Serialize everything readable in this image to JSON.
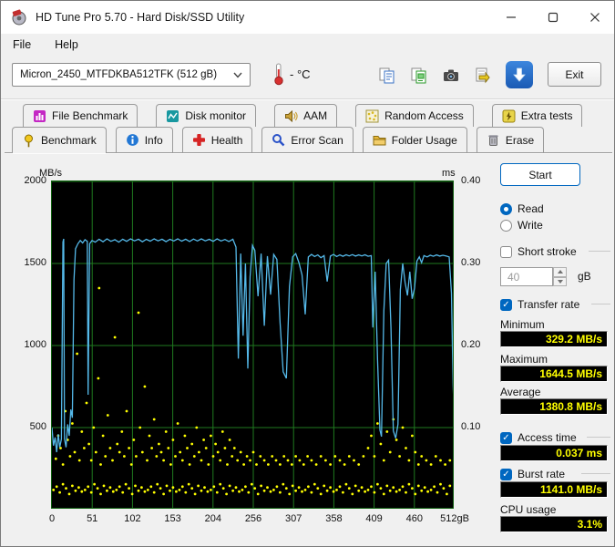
{
  "window": {
    "title": "HD Tune Pro 5.70 - Hard Disk/SSD Utility"
  },
  "menu": {
    "file": "File",
    "help": "Help"
  },
  "toolbar": {
    "drive_select": "Micron_2450_MTFDKBA512TFK (512 gB)",
    "temperature": "- °C",
    "exit": "Exit"
  },
  "tabs": {
    "active": "Benchmark",
    "row1": [
      {
        "label": "File Benchmark"
      },
      {
        "label": "Disk monitor"
      },
      {
        "label": "AAM"
      },
      {
        "label": "Random Access"
      },
      {
        "label": "Extra tests"
      }
    ],
    "row2": [
      {
        "label": "Benchmark"
      },
      {
        "label": "Info"
      },
      {
        "label": "Health"
      },
      {
        "label": "Error Scan"
      },
      {
        "label": "Folder Usage"
      },
      {
        "label": "Erase"
      }
    ]
  },
  "panel": {
    "start": "Start",
    "read": "Read",
    "read_checked": true,
    "write": "Write",
    "write_checked": false,
    "short_stroke": "Short stroke",
    "short_stroke_checked": false,
    "short_stroke_value": "40",
    "short_stroke_unit": "gB",
    "transfer_rate": "Transfer rate",
    "transfer_rate_checked": true,
    "minimum_label": "Minimum",
    "minimum_value": "329.2 MB/s",
    "maximum_label": "Maximum",
    "maximum_value": "1644.5 MB/s",
    "average_label": "Average",
    "average_value": "1380.8 MB/s",
    "access_time": "Access time",
    "access_time_checked": true,
    "access_time_value": "0.037 ms",
    "burst_rate": "Burst rate",
    "burst_rate_checked": true,
    "burst_rate_value": "1141.0 MB/s",
    "cpu_usage_label": "CPU usage",
    "cpu_usage_value": "3.1%"
  },
  "chart_data": {
    "type": "line",
    "title": "HD Tune benchmark: transfer rate and access time vs position",
    "left_axis": {
      "label": "MB/s",
      "min": 0,
      "max": 2000,
      "ticks": [
        2000,
        1500,
        1000,
        500
      ]
    },
    "right_axis": {
      "label": "ms",
      "min": 0,
      "max": 0.4,
      "ticks": [
        "0.40",
        "0.30",
        "0.20",
        "0.10"
      ]
    },
    "x_axis": {
      "min": 0,
      "max": 512,
      "tick_labels": [
        "0",
        "51",
        "102",
        "153",
        "204",
        "256",
        "307",
        "358",
        "409",
        "460",
        "512gB"
      ]
    },
    "colors": {
      "plot_bg": "#000000",
      "grid": "#1f7a1f",
      "transfer_line": "#55b9e9",
      "access_dots": "#ffff00"
    },
    "series": [
      {
        "name": "transfer_rate_mbs",
        "points": [
          [
            0,
            500
          ],
          [
            2,
            390
          ],
          [
            4,
            440
          ],
          [
            6,
            350
          ],
          [
            8,
            460
          ],
          [
            10,
            380
          ],
          [
            12,
            430
          ],
          [
            14,
            1630
          ],
          [
            15,
            1650
          ],
          [
            16,
            430
          ],
          [
            18,
            380
          ],
          [
            20,
            520
          ],
          [
            22,
            450
          ],
          [
            24,
            610
          ],
          [
            26,
            560
          ],
          [
            28,
            1400
          ],
          [
            30,
            1590
          ],
          [
            33,
            1620
          ],
          [
            36,
            1640
          ],
          [
            39,
            1625
          ],
          [
            42,
            1645
          ],
          [
            45,
            1635
          ],
          [
            46,
            700
          ],
          [
            48,
            1620
          ],
          [
            51,
            1640
          ],
          [
            55,
            1630
          ],
          [
            60,
            1648
          ],
          [
            65,
            1632
          ],
          [
            70,
            1650
          ],
          [
            75,
            1635
          ],
          [
            80,
            1645
          ],
          [
            85,
            1630
          ],
          [
            90,
            1648
          ],
          [
            95,
            1635
          ],
          [
            100,
            1650
          ],
          [
            105,
            1638
          ],
          [
            110,
            1648
          ],
          [
            115,
            1632
          ],
          [
            120,
            1647
          ],
          [
            125,
            1636
          ],
          [
            130,
            1650
          ],
          [
            135,
            1638
          ],
          [
            140,
            1648
          ],
          [
            145,
            1633
          ],
          [
            150,
            1647
          ],
          [
            155,
            1637
          ],
          [
            160,
            1650
          ],
          [
            165,
            1636
          ],
          [
            170,
            1648
          ],
          [
            175,
            1634
          ],
          [
            180,
            1649
          ],
          [
            185,
            1637
          ],
          [
            190,
            1650
          ],
          [
            195,
            1638
          ],
          [
            200,
            1647
          ],
          [
            205,
            1635
          ],
          [
            210,
            1650
          ],
          [
            215,
            1637
          ],
          [
            220,
            1646
          ],
          [
            225,
            1634
          ],
          [
            230,
            1648
          ],
          [
            234,
            1600
          ],
          [
            237,
            920
          ],
          [
            240,
            1560
          ],
          [
            243,
            1060
          ],
          [
            246,
            1500
          ],
          [
            249,
            860
          ],
          [
            252,
            1420
          ],
          [
            255,
            1610
          ],
          [
            258,
            1580
          ],
          [
            262,
            1300
          ],
          [
            266,
            1560
          ],
          [
            270,
            1120
          ],
          [
            274,
            1545
          ],
          [
            278,
            1310
          ],
          [
            282,
            1555
          ],
          [
            286,
            1525
          ],
          [
            290,
            1140
          ],
          [
            294,
            840
          ],
          [
            298,
            800
          ],
          [
            302,
            1360
          ],
          [
            306,
            1540
          ],
          [
            310,
            1560
          ],
          [
            314,
            1505
          ],
          [
            318,
            1430
          ],
          [
            322,
            1190
          ],
          [
            326,
            1540
          ],
          [
            330,
            1555
          ],
          [
            334,
            1542
          ],
          [
            338,
            1552
          ],
          [
            342,
            1535
          ],
          [
            346,
            1548
          ],
          [
            350,
            1390
          ],
          [
            354,
            1545
          ],
          [
            358,
            1555
          ],
          [
            362,
            1542
          ],
          [
            366,
            1552
          ],
          [
            370,
            1544
          ],
          [
            374,
            1553
          ],
          [
            378,
            1546
          ],
          [
            382,
            1554
          ],
          [
            386,
            1545
          ],
          [
            390,
            1552
          ],
          [
            394,
            1546
          ],
          [
            398,
            1553
          ],
          [
            402,
            1544
          ],
          [
            406,
            1548
          ],
          [
            408,
            1110
          ],
          [
            411,
            1450
          ],
          [
            414,
            910
          ],
          [
            417,
            485
          ],
          [
            419,
            445
          ],
          [
            422,
            1210
          ],
          [
            425,
            1500
          ],
          [
            428,
            1520
          ],
          [
            431,
            1110
          ],
          [
            434,
            480
          ],
          [
            437,
            435
          ],
          [
            440,
            520
          ],
          [
            443,
            1340
          ],
          [
            446,
            1500
          ],
          [
            449,
            1385
          ],
          [
            452,
            1305
          ],
          [
            455,
            1450
          ],
          [
            458,
            1285
          ],
          [
            461,
            1350
          ],
          [
            464,
            1515
          ],
          [
            467,
            1540
          ],
          [
            470,
            1505
          ],
          [
            473,
            1548
          ],
          [
            477,
            1540
          ],
          [
            481,
            1550
          ],
          [
            485,
            1544
          ],
          [
            489,
            1552
          ],
          [
            493,
            1545
          ],
          [
            497,
            1550
          ],
          [
            501,
            1546
          ],
          [
            505,
            1540
          ],
          [
            508,
            1320
          ],
          [
            510,
            760
          ],
          [
            512,
            480
          ]
        ]
      },
      {
        "name": "access_time_ms",
        "points": [
          [
            5,
            0.062
          ],
          [
            8,
            0.09
          ],
          [
            11,
            0.075
          ],
          [
            14,
            0.055
          ],
          [
            17,
            0.12
          ],
          [
            20,
            0.085
          ],
          [
            23,
            0.065
          ],
          [
            26,
            0.105
          ],
          [
            29,
            0.07
          ],
          [
            32,
            0.19
          ],
          [
            35,
            0.06
          ],
          [
            38,
            0.095
          ],
          [
            41,
            0.075
          ],
          [
            44,
            0.13
          ],
          [
            47,
            0.08
          ],
          [
            50,
            0.06
          ],
          [
            53,
            0.1
          ],
          [
            56,
            0.07
          ],
          [
            59,
            0.16
          ],
          [
            60,
            0.27
          ],
          [
            62,
            0.055
          ],
          [
            65,
            0.09
          ],
          [
            68,
            0.065
          ],
          [
            71,
            0.115
          ],
          [
            74,
            0.075
          ],
          [
            77,
            0.06
          ],
          [
            80,
            0.21
          ],
          [
            83,
            0.08
          ],
          [
            86,
            0.07
          ],
          [
            89,
            0.095
          ],
          [
            92,
            0.065
          ],
          [
            95,
            0.12
          ],
          [
            98,
            0.075
          ],
          [
            101,
            0.055
          ],
          [
            104,
            0.085
          ],
          [
            107,
            0.065
          ],
          [
            110,
            0.24
          ],
          [
            112,
            0.1
          ],
          [
            115,
            0.07
          ],
          [
            118,
            0.15
          ],
          [
            121,
            0.06
          ],
          [
            124,
            0.09
          ],
          [
            127,
            0.075
          ],
          [
            130,
            0.11
          ],
          [
            133,
            0.065
          ],
          [
            136,
            0.08
          ],
          [
            139,
            0.07
          ],
          [
            142,
            0.06
          ],
          [
            145,
            0.095
          ],
          [
            148,
            0.075
          ],
          [
            151,
            0.055
          ],
          [
            154,
            0.085
          ],
          [
            157,
            0.065
          ],
          [
            160,
            0.105
          ],
          [
            163,
            0.07
          ],
          [
            166,
            0.06
          ],
          [
            169,
            0.09
          ],
          [
            172,
            0.075
          ],
          [
            175,
            0.055
          ],
          [
            178,
            0.08
          ],
          [
            181,
            0.065
          ],
          [
            184,
            0.1
          ],
          [
            187,
            0.07
          ],
          [
            190,
            0.06
          ],
          [
            193,
            0.085
          ],
          [
            196,
            0.075
          ],
          [
            199,
            0.055
          ],
          [
            202,
            0.09
          ],
          [
            205,
            0.065
          ],
          [
            208,
            0.08
          ],
          [
            211,
            0.07
          ],
          [
            214,
            0.06
          ],
          [
            217,
            0.095
          ],
          [
            220,
            0.075
          ],
          [
            223,
            0.055
          ],
          [
            226,
            0.085
          ],
          [
            229,
            0.065
          ],
          [
            232,
            0.075
          ],
          [
            236,
            0.06
          ],
          [
            240,
            0.07
          ],
          [
            244,
            0.055
          ],
          [
            248,
            0.065
          ],
          [
            252,
            0.06
          ],
          [
            256,
            0.07
          ],
          [
            260,
            0.055
          ],
          [
            265,
            0.065
          ],
          [
            270,
            0.06
          ],
          [
            275,
            0.055
          ],
          [
            280,
            0.065
          ],
          [
            285,
            0.06
          ],
          [
            290,
            0.055
          ],
          [
            295,
            0.065
          ],
          [
            300,
            0.06
          ],
          [
            305,
            0.055
          ],
          [
            310,
            0.065
          ],
          [
            315,
            0.06
          ],
          [
            320,
            0.055
          ],
          [
            325,
            0.065
          ],
          [
            330,
            0.06
          ],
          [
            336,
            0.055
          ],
          [
            342,
            0.065
          ],
          [
            348,
            0.06
          ],
          [
            354,
            0.055
          ],
          [
            360,
            0.065
          ],
          [
            366,
            0.06
          ],
          [
            372,
            0.055
          ],
          [
            378,
            0.065
          ],
          [
            384,
            0.06
          ],
          [
            390,
            0.055
          ],
          [
            396,
            0.065
          ],
          [
            402,
            0.075
          ],
          [
            406,
            0.09
          ],
          [
            410,
            0.065
          ],
          [
            414,
            0.105
          ],
          [
            418,
            0.08
          ],
          [
            422,
            0.06
          ],
          [
            426,
            0.095
          ],
          [
            430,
            0.07
          ],
          [
            434,
            0.11
          ],
          [
            438,
            0.085
          ],
          [
            442,
            0.065
          ],
          [
            446,
            0.1
          ],
          [
            450,
            0.075
          ],
          [
            454,
            0.06
          ],
          [
            458,
            0.09
          ],
          [
            462,
            0.07
          ],
          [
            466,
            0.055
          ],
          [
            470,
            0.065
          ],
          [
            476,
            0.06
          ],
          [
            482,
            0.055
          ],
          [
            488,
            0.065
          ],
          [
            494,
            0.06
          ],
          [
            500,
            0.055
          ],
          [
            506,
            0.06
          ]
        ]
      }
    ],
    "access_band": {
      "x_start": 2,
      "x_step": 4,
      "count": 127,
      "ms_cycle": [
        0.024,
        0.028,
        0.021,
        0.031,
        0.026,
        0.019,
        0.029,
        0.023,
        0.027,
        0.022
      ]
    }
  }
}
